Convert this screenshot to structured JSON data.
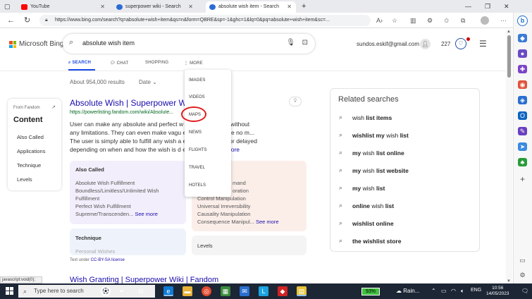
{
  "browser": {
    "tabs": [
      {
        "title": "YouTube",
        "fav_color": "#ff0000"
      },
      {
        "title": "superpower wiki - Search",
        "fav_color": "#2b6cd4"
      },
      {
        "title": "absolute wish item - Search",
        "fav_color": "#2b6cd4"
      }
    ],
    "new_tab": "+",
    "url": "https://www.bing.com/search?q=absolute+wish+item&qs=n&form=QBRE&sp=-1&ghc=1&lq=0&pq=absolute+wish+item&sc=...",
    "status_link": "javascript:void(0);"
  },
  "bing": {
    "logo_text": "Microsoft Bing",
    "query": "absolute wish item",
    "email": "sundos.eskif@gmail.com",
    "points": "227",
    "nav": {
      "search": "SEARCH",
      "chat": "CHAT",
      "shopping": "SHOPPING",
      "more": "MORE"
    },
    "result_count": "About 954,000 results",
    "date_filter": "Date ⌄",
    "more_menu": [
      "IMAGES",
      "VIDEOS",
      "MAPS",
      "NEWS",
      "FLIGHTS",
      "TRAVEL",
      "HOTELS"
    ]
  },
  "fandom_panel": {
    "source": "From Fandom",
    "title": "Content",
    "items": [
      "Also Called",
      "Applications",
      "Technique",
      "Levels"
    ]
  },
  "result1": {
    "title": "Absolute Wish | Superpower Wiki",
    "url": "https://powerlisting.fandom.com/wiki/Absolute...",
    "snippet_lines": [
      "User can make any absolute and perfect w         elves and others without",
      "any limitations. They can even make vagu          e wishes come true no m...",
      "The user is simply able to fulfill any wish a            erfectly; instantly or delayed",
      "depending on when and how the wish is d          er, but is ..."
    ],
    "see_more": "See more",
    "card_also_called": {
      "heading": "Also Called",
      "lines": [
        "Absolute Wish Fulfillment",
        "Boundless/Limitless/Unlimited Wish",
        "Fulfillment",
        "Perfect Wish Fulfillment",
        "Supreme/Transcenden..."
      ],
      "more": "See more"
    },
    "card_applications": {
      "lines": [
        "mand",
        "oration",
        "Control Manipulation",
        "Universal Irreversibility",
        "Causality Manipulation",
        "Consequence Manipul..."
      ],
      "more": "See more"
    },
    "card_technique": {
      "heading": "Technique",
      "line": "Personal Wishes"
    },
    "card_levels": {
      "heading": "Levels"
    },
    "license_prefix": "Text under ",
    "license": "CC-BY-SA license"
  },
  "result2": {
    "title": "Wish Granting | Superpower Wiki | Fandom"
  },
  "related": {
    "title": "Related searches",
    "items": [
      {
        "plain": "wish ",
        "bold": "list items"
      },
      {
        "plain": "",
        "bold": "wishlist my",
        "plain2": " wish ",
        "bold2": "list"
      },
      {
        "plain": "",
        "bold": "my",
        "plain2": " wish ",
        "bold2": "list online"
      },
      {
        "plain": "",
        "bold": "my",
        "plain2": " wish ",
        "bold2": "list website"
      },
      {
        "plain": "",
        "bold": "my",
        "plain2": " wish ",
        "bold2": "list"
      },
      {
        "plain": "",
        "bold": "online",
        "plain2": " wish ",
        "bold2": "list"
      },
      {
        "plain": "",
        "bold": "wishlist online"
      },
      {
        "plain": "",
        "bold": "the wishlist store"
      }
    ]
  },
  "taskbar": {
    "search_placeholder": "Type here to search",
    "battery": "93%",
    "weather": "Rain...",
    "lang": "ENG",
    "time": "10:56",
    "date": "14/05/2023"
  },
  "colors": {
    "accent": "#174ae4",
    "link": "#1a0dab",
    "annotation": "#e01b1b"
  }
}
